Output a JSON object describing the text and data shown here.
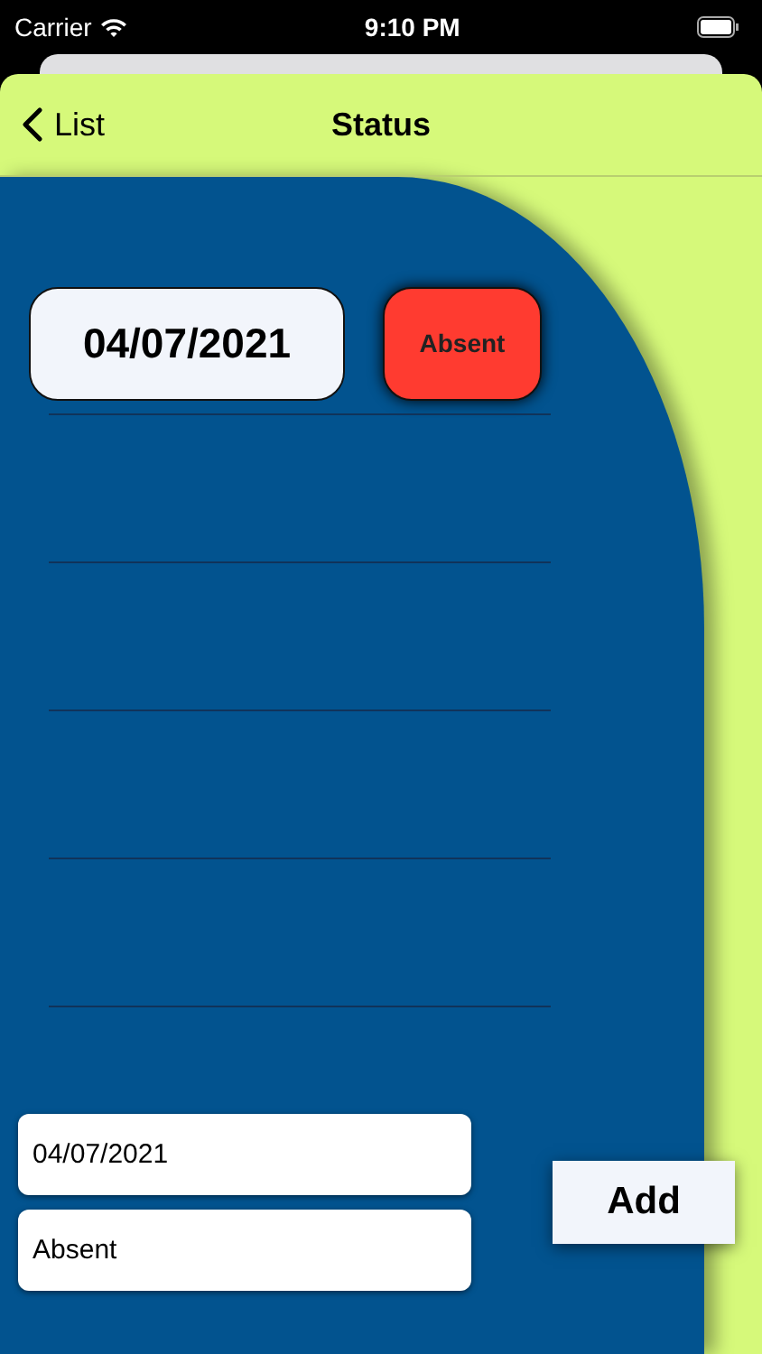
{
  "status_bar": {
    "carrier": "Carrier",
    "time": "9:10 PM"
  },
  "nav": {
    "back_label": "List",
    "title": "Status"
  },
  "rows": [
    {
      "date": "04/07/2021",
      "status": "Absent",
      "color": "#ff3b30"
    }
  ],
  "form": {
    "date_value": "04/07/2021",
    "status_value": "Absent",
    "button": "Add"
  }
}
